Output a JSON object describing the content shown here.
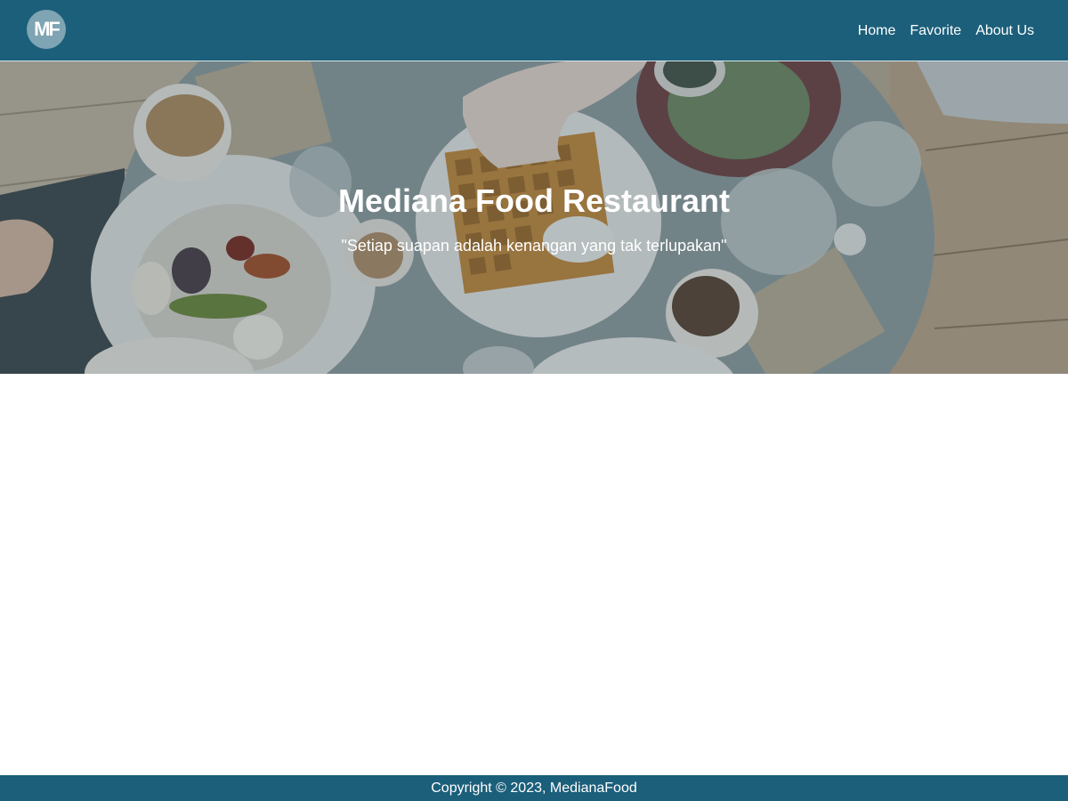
{
  "header": {
    "logo_text": "MF",
    "logo_icon": "mf-logo-icon",
    "nav": [
      {
        "label": "Home"
      },
      {
        "label": "Favorite"
      },
      {
        "label": "About Us"
      }
    ]
  },
  "hero": {
    "title": "Mediana Food Restaurant",
    "tagline": "\"Setiap suapan adalah kenangan yang tak terlupakan\""
  },
  "footer": {
    "copyright": "Copyright © 2023, MedianaFood"
  },
  "colors": {
    "primary": "#1b5f7a",
    "text_light": "#ffffff",
    "logo_bg": "#7fa4b3"
  }
}
